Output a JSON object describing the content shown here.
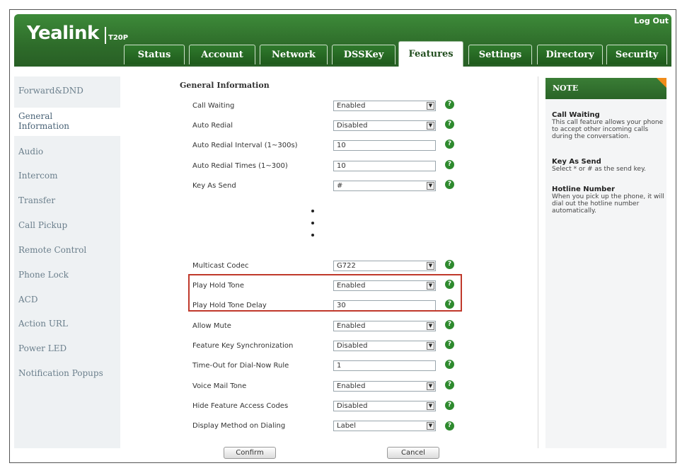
{
  "header": {
    "logo": "Yealink",
    "model": "T20P",
    "logout": "Log Out"
  },
  "tabs": [
    "Status",
    "Account",
    "Network",
    "DSSKey",
    "Features",
    "Settings",
    "Directory",
    "Security"
  ],
  "active_tab": "Features",
  "sidebar": {
    "items": [
      "Forward&DND",
      "General Information",
      "Audio",
      "Intercom",
      "Transfer",
      "Call Pickup",
      "Remote Control",
      "Phone Lock",
      "ACD",
      "Action URL",
      "Power LED",
      "Notification Popups"
    ],
    "active": "General Information"
  },
  "main": {
    "section_title": "General Information",
    "rows_top": [
      {
        "label": "Call Waiting",
        "value": "Enabled",
        "type": "select"
      },
      {
        "label": "Auto Redial",
        "value": "Disabled",
        "type": "select"
      },
      {
        "label": "Auto Redial Interval (1~300s)",
        "value": "10",
        "type": "text"
      },
      {
        "label": "Auto Redial Times (1~300)",
        "value": "10",
        "type": "text"
      },
      {
        "label": "Key As Send",
        "value": "#",
        "type": "select"
      }
    ],
    "rows_bottom": [
      {
        "label": "Multicast Codec",
        "value": "G722",
        "type": "select"
      },
      {
        "label": "Play Hold Tone",
        "value": "Enabled",
        "type": "select"
      },
      {
        "label": "Play Hold Tone Delay",
        "value": "30",
        "type": "text"
      },
      {
        "label": "Allow Mute",
        "value": "Enabled",
        "type": "select"
      },
      {
        "label": "Feature Key Synchronization",
        "value": "Disabled",
        "type": "select"
      },
      {
        "label": "Time-Out for Dial-Now Rule",
        "value": "1",
        "type": "text"
      },
      {
        "label": "Voice Mail Tone",
        "value": "Enabled",
        "type": "select"
      },
      {
        "label": "Hide Feature Access Codes",
        "value": "Disabled",
        "type": "select"
      },
      {
        "label": "Display Method on Dialing",
        "value": "Label",
        "type": "select"
      }
    ],
    "confirm": "Confirm",
    "cancel": "Cancel"
  },
  "note": {
    "title": "NOTE",
    "entries": [
      {
        "heading": "Call Waiting",
        "text": "This call feature allows your phone to accept other incoming calls during the conversation."
      },
      {
        "heading": "Key As Send",
        "text": "Select * or # as the send key."
      },
      {
        "heading": "Hotline Number",
        "text": "When you pick up the phone, it will dial out the hotline number automatically."
      }
    ]
  },
  "colors": {
    "brand_green": "#2e6c2a",
    "help_green": "#2e8a2e",
    "highlight": "#c0392b",
    "note_corner": "#f08c1a"
  }
}
